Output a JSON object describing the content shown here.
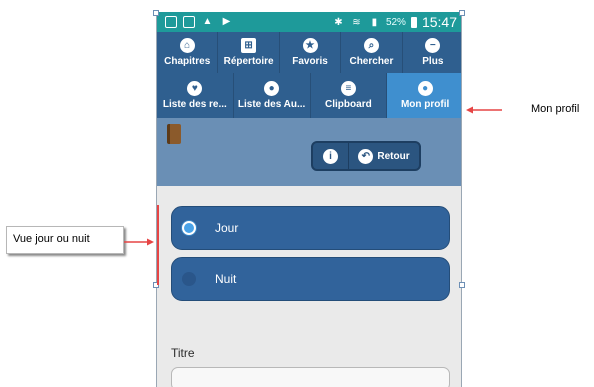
{
  "statusbar": {
    "battery_pct": "52%",
    "time": "15:47"
  },
  "nav_row1": [
    {
      "label": "Chapitres",
      "icon": "home-icon"
    },
    {
      "label": "Répertoire",
      "icon": "grid-icon"
    },
    {
      "label": "Favoris",
      "icon": "star-icon"
    },
    {
      "label": "Chercher",
      "icon": "search-icon"
    },
    {
      "label": "Plus",
      "icon": "minus-icon"
    }
  ],
  "nav_row2": [
    {
      "label": "Liste des re...",
      "icon": "heart-icon"
    },
    {
      "label": "Liste des Au...",
      "icon": "user-icon"
    },
    {
      "label": "Clipboard",
      "icon": "list-icon"
    },
    {
      "label": "Mon profil",
      "icon": "user-icon",
      "active": true
    }
  ],
  "toolbar": {
    "back_label": "Retour"
  },
  "mode_options": [
    {
      "label": "Jour",
      "selected": true
    },
    {
      "label": "Nuit",
      "selected": false
    }
  ],
  "form": {
    "title_label": "Titre",
    "title_value": ""
  },
  "annotations": {
    "profile_callout": "Mon profil",
    "mode_callout": "Vue jour ou nuit"
  },
  "colors": {
    "statusbar": "#1e9a9a",
    "nav": "#2f5f8f",
    "nav_active": "#3f8fcf",
    "toolbar": "#6a8fb5",
    "option_bg": "#31639b",
    "arrow": "#e64545"
  }
}
